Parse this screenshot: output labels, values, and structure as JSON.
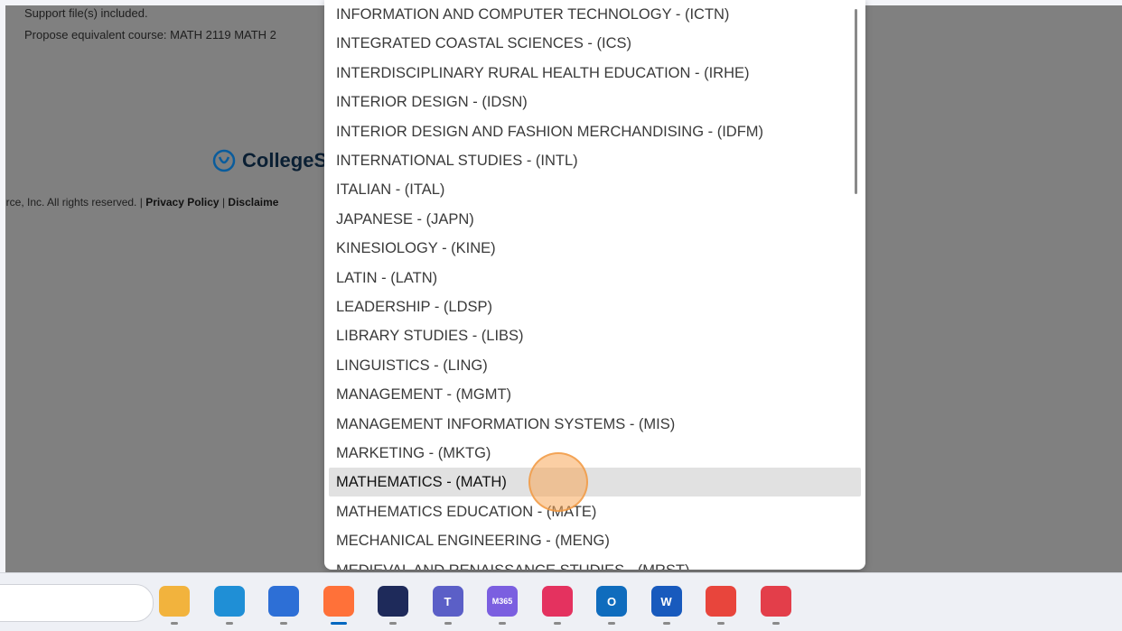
{
  "background_page": {
    "support_text": "Support file(s) included.",
    "propose_text": "Propose equivalent course: MATH 2119 MATH 2",
    "logo_text": "CollegeS",
    "footer_copyright": "urce, Inc. All rights reserved. |",
    "footer_privacy": "Privacy Policy",
    "footer_sep": "|",
    "footer_disclaimer": "Disclaime"
  },
  "dropdown": {
    "options": [
      "INFORMATION AND COMPUTER TECHNOLOGY - (ICTN)",
      "INTEGRATED COASTAL SCIENCES - (ICS)",
      "INTERDISCIPLINARY RURAL HEALTH EDUCATION - (IRHE)",
      "INTERIOR DESIGN - (IDSN)",
      "INTERIOR DESIGN AND FASHION MERCHANDISING - (IDFM)",
      "INTERNATIONAL STUDIES - (INTL)",
      "ITALIAN - (ITAL)",
      "JAPANESE - (JAPN)",
      "KINESIOLOGY - (KINE)",
      "LATIN - (LATN)",
      "LEADERSHIP - (LDSP)",
      "LIBRARY STUDIES - (LIBS)",
      "LINGUISTICS - (LING)",
      "MANAGEMENT - (MGMT)",
      "MANAGEMENT INFORMATION SYSTEMS - (MIS)",
      "MARKETING - (MKTG)",
      "MATHEMATICS - (MATH)",
      "MATHEMATICS EDUCATION - (MATE)",
      "MECHANICAL ENGINEERING - (MENG)",
      "MEDIEVAL AND RENAISSANCE STUDIES - (MRST)"
    ],
    "highlighted": "MATHEMATICS - (MATH)"
  },
  "taskbar": {
    "icons": [
      {
        "name": "file-explorer-icon",
        "color": "#f2b33d",
        "label": ""
      },
      {
        "name": "edge-icon",
        "color": "#1f8fd6",
        "label": ""
      },
      {
        "name": "company-portal-icon",
        "color": "#2d6fd6",
        "label": ""
      },
      {
        "name": "firefox-icon",
        "color": "#ff7139",
        "label": ""
      },
      {
        "name": "vpn-icon",
        "color": "#1e2a5a",
        "label": ""
      },
      {
        "name": "teams-icon",
        "color": "#5b5fc7",
        "label": "T"
      },
      {
        "name": "m365-icon",
        "color": "#7b5fe0",
        "label": "M365"
      },
      {
        "name": "creative-cloud-icon",
        "color": "#e4325f",
        "label": ""
      },
      {
        "name": "outlook-icon",
        "color": "#0f6cbd",
        "label": "O"
      },
      {
        "name": "word-icon",
        "color": "#185abd",
        "label": "W"
      },
      {
        "name": "chrome-icon",
        "color": "#e8453c",
        "label": ""
      },
      {
        "name": "scribe-icon",
        "color": "#e33e4a",
        "label": ""
      }
    ]
  }
}
